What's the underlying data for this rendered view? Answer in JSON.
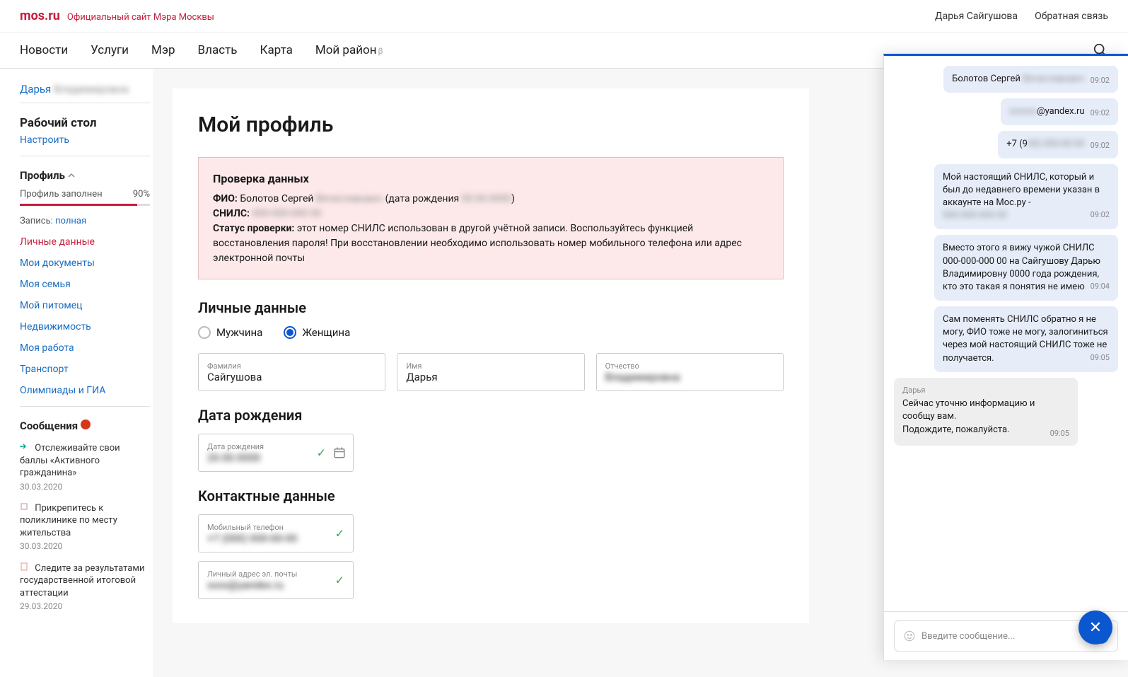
{
  "header": {
    "logo": "mos.ru",
    "tagline": "Официальный сайт Мэра Москвы",
    "user": "Дарья Сайгушова",
    "feedback": "Обратная связь"
  },
  "nav": {
    "items": [
      "Новости",
      "Услуги",
      "Мэр",
      "Власть",
      "Карта",
      "Мой район"
    ],
    "beta": "β"
  },
  "sidebar": {
    "user_first": "Дарья",
    "user_last": "Владимировна",
    "desktop": "Рабочий стол",
    "configure": "Настроить",
    "profile": "Профиль",
    "progress_label": "Профиль заполнен",
    "progress_value": "90%",
    "record_label": "Запись:",
    "record_value": "полная",
    "menu": [
      "Личные данные",
      "Мои документы",
      "Моя семья",
      "Мой питомец",
      "Недвижимость",
      "Моя работа",
      "Транспорт",
      "Олимпиады и ГИА"
    ],
    "messages_heading": "Сообщения",
    "messages": [
      {
        "title": "Отслеживайте свои баллы «Активного гражданина»",
        "date": "30.03.2020"
      },
      {
        "title": "Прикрепитесь к поликлинике по месту жительства",
        "date": "30.03.2020"
      },
      {
        "title": "Следите за результатами государственной итоговой аттестации",
        "date": "29.03.2020"
      }
    ]
  },
  "profile": {
    "title": "Мой профиль",
    "alert": {
      "heading": "Проверка данных",
      "fio_label": "ФИО:",
      "fio_value": "Болотов Сергей",
      "fio_blur": "Вячеславович",
      "dob_label": "(дата рождения",
      "dob_blur": "00.00.0000",
      "dob_close": ")",
      "snils_label": "СНИЛС:",
      "snils_blur": "000-000-000 00",
      "status_label": "Статус проверки:",
      "status_text": "этот номер СНИЛС использован в другой учётной записи. Воспользуйтесь функцией восстановления пароля! При восстановлении необходимо использовать номер мобильного телефона или адрес электронной почты"
    },
    "personal_section": "Личные данные",
    "gender": {
      "m": "Мужчина",
      "f": "Женщина"
    },
    "fields": {
      "surname_label": "Фамилия",
      "surname_value": "Сайгушова",
      "name_label": "Имя",
      "name_value": "Дарья",
      "patronymic_label": "Отчество",
      "patronymic_value": "Владимировна"
    },
    "dob_section": "Дата рождения",
    "dob_field": {
      "label": "Дата рождения",
      "value": "20.00.0000"
    },
    "contact_section": "Контактные данные",
    "phone_field": {
      "label": "Мобильный телефон",
      "value": "+7 (000) 000-00-00"
    },
    "email_field": {
      "label": "Личный адрес эл. почты",
      "value": "xxxx@yandex.ru"
    }
  },
  "chat": {
    "input_placeholder": "Введите сообщение...",
    "messages": [
      {
        "who": "user",
        "text": "Болотов Сергей ",
        "blur": "Вячеславович",
        "time": "09:02"
      },
      {
        "who": "user",
        "blur_pre": "xxxxxx",
        "text": "@yandex.ru",
        "time": "09:02"
      },
      {
        "who": "user",
        "text": "+7 (9",
        "blur": "00) 000-00-00",
        "time": "09:02"
      },
      {
        "who": "user",
        "text": "Мой настоящий СНИЛС, который и был до недавнего времени указан в аккаунте на Мос.ру - ",
        "blur": "000-000-000 00",
        "time": "09:02"
      },
      {
        "who": "user",
        "text": "Вместо этого я вижу чужой СНИЛС 000-000-000 00 на Сайгушову Дарью Владимировну 0000 года рождения, кто это такая я понятия не имею",
        "time": "09:04"
      },
      {
        "who": "user",
        "text": "Сам поменять СНИЛС обратно я не могу, ФИО тоже не могу, залогиниться через мой настоящий СНИЛС тоже не получается.",
        "time": "09:05"
      },
      {
        "who": "agent",
        "name": "Дарья",
        "text": "Сейчас уточню информацию и сообщу вам.\nПодождите, пожалуйста.",
        "time": "09:05"
      }
    ]
  }
}
